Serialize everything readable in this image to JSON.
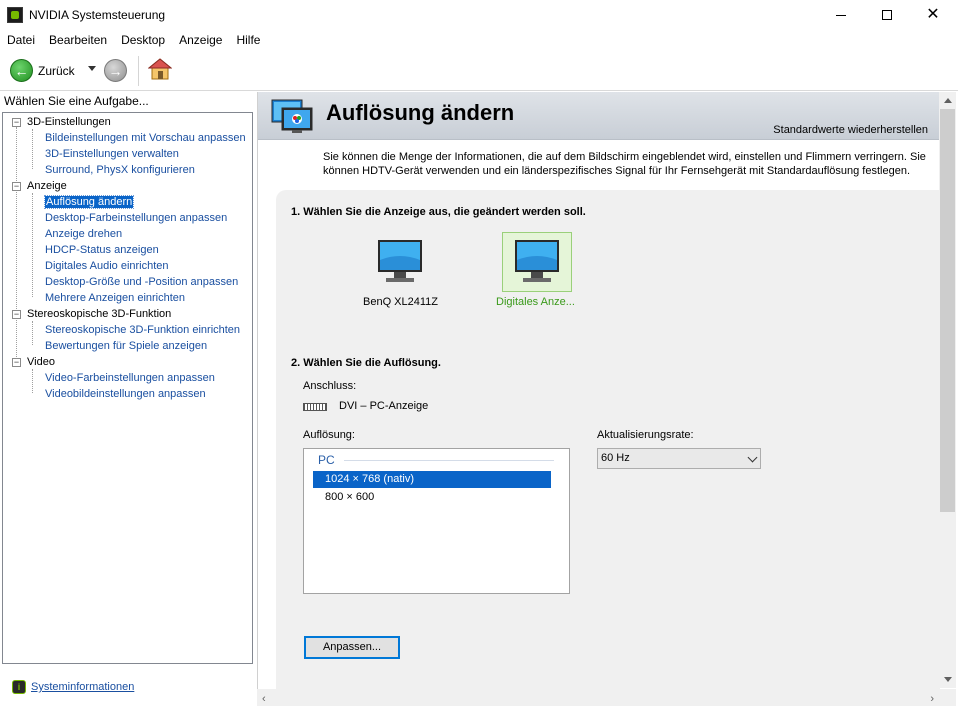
{
  "window": {
    "title": "NVIDIA Systemsteuerung"
  },
  "menu": [
    "Datei",
    "Bearbeiten",
    "Desktop",
    "Anzeige",
    "Hilfe"
  ],
  "toolbar": {
    "back_label": "Zurück"
  },
  "left": {
    "header": "Wählen Sie eine Aufgabe...",
    "tree": [
      {
        "label": "3D-Einstellungen",
        "type": "category"
      },
      {
        "label": "Bildeinstellungen mit Vorschau anpassen",
        "type": "link"
      },
      {
        "label": "3D-Einstellungen verwalten",
        "type": "link"
      },
      {
        "label": "Surround, PhysX konfigurieren",
        "type": "link"
      },
      {
        "label": "Anzeige",
        "type": "category"
      },
      {
        "label": "Auflösung ändern",
        "type": "link",
        "selected": true
      },
      {
        "label": "Desktop-Farbeinstellungen anpassen",
        "type": "link"
      },
      {
        "label": "Anzeige drehen",
        "type": "link"
      },
      {
        "label": "HDCP-Status anzeigen",
        "type": "link"
      },
      {
        "label": "Digitales Audio einrichten",
        "type": "link"
      },
      {
        "label": "Desktop-Größe und -Position anpassen",
        "type": "link"
      },
      {
        "label": "Mehrere Anzeigen einrichten",
        "type": "link"
      },
      {
        "label": "Stereoskopische 3D-Funktion",
        "type": "category"
      },
      {
        "label": "Stereoskopische 3D-Funktion einrichten",
        "type": "link"
      },
      {
        "label": "Bewertungen für Spiele anzeigen",
        "type": "link"
      },
      {
        "label": "Video",
        "type": "category"
      },
      {
        "label": "Video-Farbeinstellungen anpassen",
        "type": "link"
      },
      {
        "label": "Videobildeinstellungen anpassen",
        "type": "link"
      }
    ],
    "sysinfo": "Systeminformationen"
  },
  "main": {
    "title": "Auflösung ändern",
    "restore": "Standardwerte wiederherstellen",
    "description": "Sie können die Menge der Informationen, die auf dem Bildschirm eingeblendet wird, einstellen und Flimmern verringern. Sie können HDTV-Gerät verwenden und ein länderspezifisches Signal für Ihr Fernsehgerät mit Standardauflösung festlegen.",
    "step1": "1. Wählen Sie die Anzeige aus, die geändert werden soll.",
    "displays": [
      {
        "label": "BenQ XL2411Z",
        "selected": false
      },
      {
        "label": "Digitales Anze...",
        "selected": true
      }
    ],
    "step2": "2. Wählen Sie die Auflösung.",
    "connection_label": "Anschluss:",
    "connection_value": "DVI – PC-Anzeige",
    "resolution_label": "Auflösung:",
    "resolution_group": "PC",
    "resolutions": [
      {
        "label": "1024 × 768 (nativ)",
        "selected": true
      },
      {
        "label": "800 × 600",
        "selected": false
      }
    ],
    "refresh_label": "Aktualisierungsrate:",
    "refresh_value": "60 Hz",
    "customize_button": "Anpassen..."
  },
  "colors": {
    "accent": "#0a64c8",
    "nvidia_green": "#76b900",
    "link": "#1a4fa0",
    "header_bg": "#d3d8df"
  }
}
